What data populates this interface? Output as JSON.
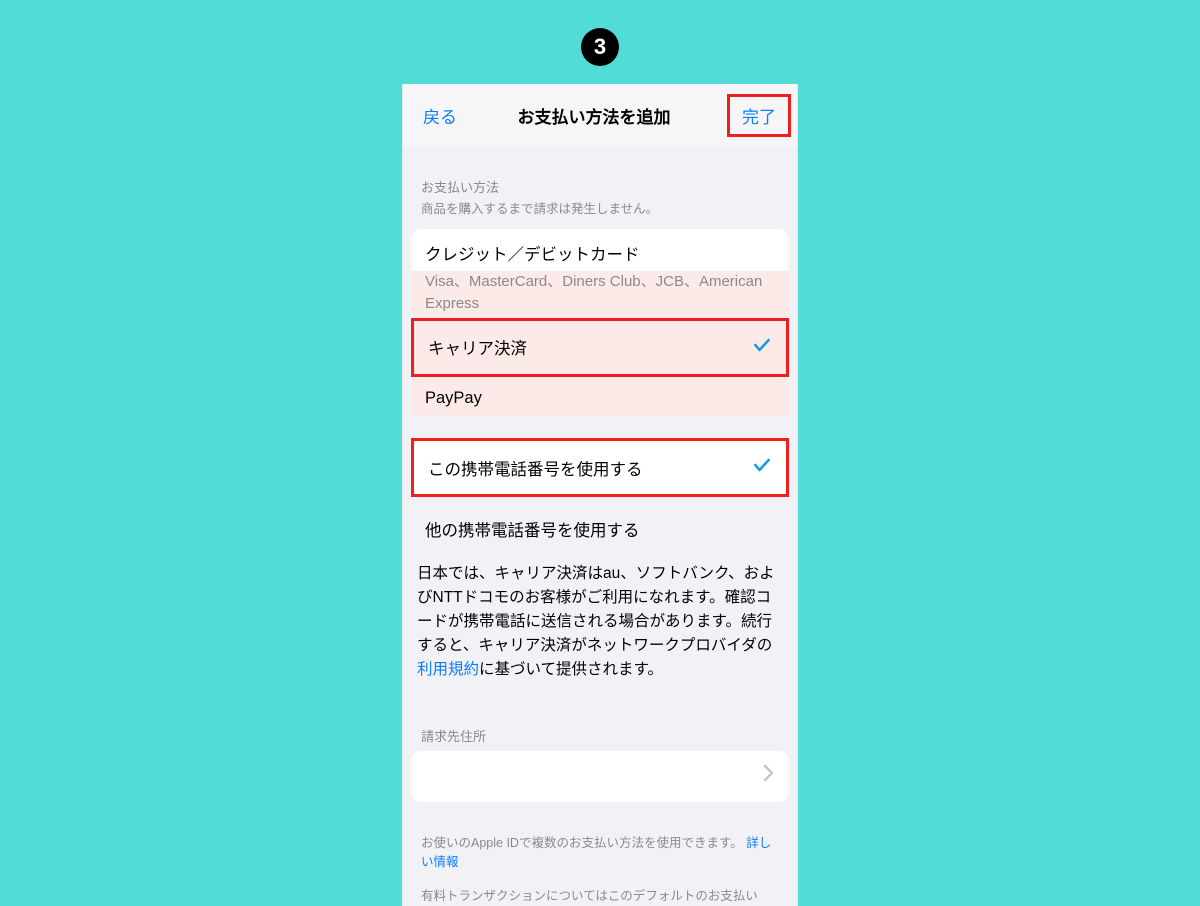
{
  "step_number": "3",
  "nav": {
    "back": "戻る",
    "title": "お支払い方法を追加",
    "done": "完了"
  },
  "section": {
    "label": "お支払い方法",
    "sub": "商品を購入するまで請求は発生しません。"
  },
  "options": {
    "card": "クレジット／デビットカード",
    "card_sub": "Visa、MasterCard、Diners Club、JCB、American Express",
    "carrier": "キャリア決済",
    "paypay": "PayPay"
  },
  "phone_choice": {
    "this_number": "この携帯電話番号を使用する",
    "other_number": "他の携帯電話番号を使用する"
  },
  "description_a": "日本では、キャリア決済はau、ソフトバンク、およびNTTドコモのお客様がご利用になれます。確認コードが携帯電話に送信される場合があります。続行すると、キャリア決済がネットワークプロバイダの",
  "description_link": "利用規約",
  "description_b": "に基づいて提供されます。",
  "billing_label": "請求先住所",
  "footer_a": "お使いのApple IDで複数のお支払い方法を使用できます。",
  "footer_link": "詳しい情報",
  "footer_b": "有料トランザクションについてはこのデフォルトのお支払い"
}
